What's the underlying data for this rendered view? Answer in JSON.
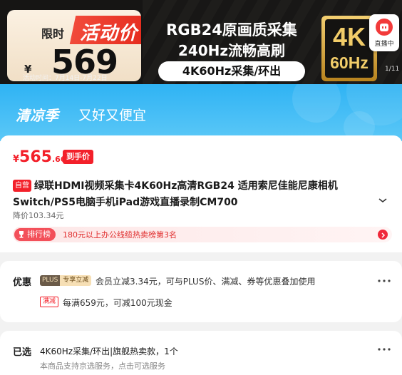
{
  "hero": {
    "limit_label": "限时",
    "activity_label": "活动价",
    "currency": "¥",
    "price": "569",
    "activity_time": "活动时间：7月14日-7月22日",
    "headline_1": "RGB24原画质采集",
    "headline_2": "240Hz流畅高刷",
    "spec_pill": "4K60Hz采集/环出",
    "badge_top": "4K",
    "badge_bottom": "60Hz",
    "live_label": "直播中",
    "pager": "1/11"
  },
  "promo": {
    "title": "清凉季",
    "subtitle": "又好又便宜"
  },
  "product": {
    "currency": "¥",
    "price_int": "565",
    "price_dec": ".66",
    "deal_tag": "到手价",
    "self_tag": "自营",
    "title_line_1": "绿联HDMI视频采集卡4K60Hz高清RGB24 适用索尼佳能尼康相机",
    "title_line_2": "Switch/PS5电脑手机iPad游戏直播录制CM700",
    "price_cut": "降价103.34元",
    "rank_label": "排行榜",
    "rank_text": "180元以上办公线缆热卖榜第3名"
  },
  "discount": {
    "label": "优惠",
    "plus": "PLUS",
    "plus_exclusive": "专享立减",
    "plus_text": "会员立减3.34元，可与PLUS价、满减、券等优惠叠加使用",
    "full_tag": "满减",
    "full_text": "每满659元，可减100元现金"
  },
  "selected": {
    "label": "已选",
    "value": "4K60Hz采集/环出|旗舰热卖款，1个",
    "note": "本商品支持京选服务，点击可选服务"
  },
  "colors": {
    "accent_red": "#f3202a",
    "promo_blue": "#2fb3f4",
    "gold": "#f2cd69"
  }
}
